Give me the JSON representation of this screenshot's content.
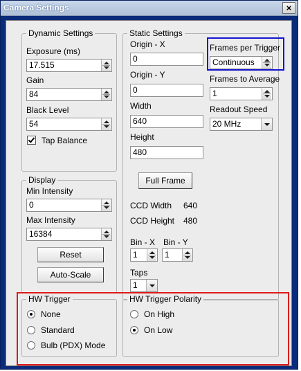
{
  "window": {
    "title": "Camera Settings",
    "close_glyph": "×"
  },
  "dynamic": {
    "legend": "Dynamic Settings",
    "exposure_label": "Exposure (ms)",
    "exposure_value": "17.515",
    "gain_label": "Gain",
    "gain_value": "84",
    "black_label": "Black Level",
    "black_value": "54",
    "tap_balance_label": "Tap Balance",
    "tap_balance_checked": true
  },
  "display": {
    "legend": "Display",
    "min_label": "Min Intensity",
    "min_value": "0",
    "max_label": "Max Intensity",
    "max_value": "16384",
    "reset_label": "Reset",
    "autoscale_label": "Auto-Scale"
  },
  "static": {
    "legend": "Static Settings",
    "origin_x_label": "Origin - X",
    "origin_x_value": "0",
    "origin_y_label": "Origin - Y",
    "origin_y_value": "0",
    "width_label": "Width",
    "width_value": "640",
    "height_label": "Height",
    "height_value": "480",
    "fpt_label": "Frames per Trigger",
    "fpt_value": "Continuous",
    "fta_label": "Frames to Average",
    "fta_value": "1",
    "readout_label": "Readout Speed",
    "readout_value": "20 MHz",
    "full_frame_label": "Full Frame",
    "ccd_width_label": "CCD Width",
    "ccd_width_value": "640",
    "ccd_height_label": "CCD Height",
    "ccd_height_value": "480",
    "bin_x_label": "Bin - X",
    "bin_x_value": "1",
    "bin_y_label": "Bin - Y",
    "bin_y_value": "1",
    "taps_label": "Taps",
    "taps_value": "1"
  },
  "hw_trigger": {
    "legend": "HW Trigger",
    "options": [
      "None",
      "Standard",
      "Bulb (PDX) Mode"
    ],
    "selected": "None"
  },
  "hw_polarity": {
    "legend": "HW Trigger Polarity",
    "options": [
      "On High",
      "On Low"
    ],
    "selected": "On Low"
  },
  "highlights": {
    "blue": "#1414d2",
    "red": "#e01818"
  }
}
